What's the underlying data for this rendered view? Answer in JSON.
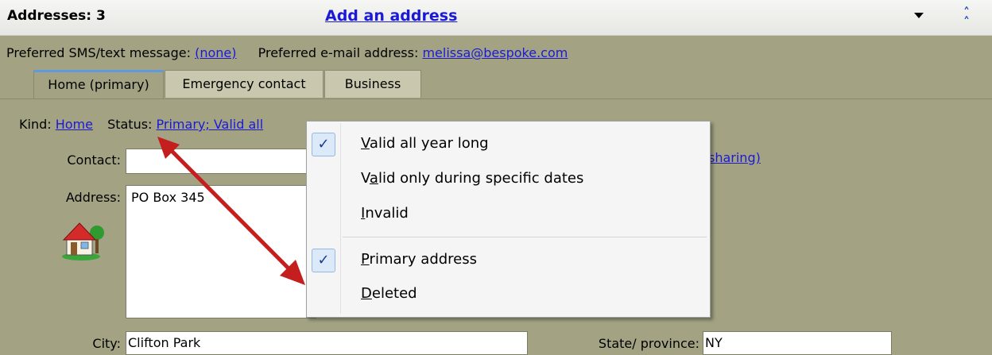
{
  "header": {
    "title": "Addresses: 3",
    "add_link": "Add an address",
    "dropdown_icon": "chevron-down-icon",
    "collapse_icon": "double-chevron-up-icon"
  },
  "preferences": {
    "sms_label": "Preferred SMS/text message:",
    "sms_value": "(none)",
    "email_label": "Preferred e-mail address:",
    "email_value": "melissa@bespoke.com"
  },
  "tabs": [
    {
      "label": "Home (primary)",
      "active": true
    },
    {
      "label": "Emergency contact",
      "active": false
    },
    {
      "label": "Business",
      "active": false
    }
  ],
  "form": {
    "kind_label": "Kind:",
    "kind_value": "Home",
    "status_label": "Status:",
    "status_value": "Primary; Valid all",
    "share_fragment": "sharing)",
    "contact_label": "Contact:",
    "contact_value": "",
    "address_label": "Address:",
    "address_value": "PO Box 345",
    "city_label": "City:",
    "city_value": "Clifton Park",
    "state_label": "State/ province:",
    "state_value": "NY"
  },
  "menu": {
    "items": [
      {
        "pre": "",
        "accel": "V",
        "post": "alid all year long",
        "checked": true
      },
      {
        "pre": "V",
        "accel": "a",
        "post": "lid only during specific dates",
        "checked": false
      },
      {
        "pre": "",
        "accel": "I",
        "post": "nvalid",
        "checked": false
      },
      {
        "pre": "",
        "accel": "P",
        "post": "rimary address",
        "checked": true
      },
      {
        "pre": "",
        "accel": "D",
        "post": "eleted",
        "checked": false
      }
    ],
    "check_glyph": "✓"
  },
  "colors": {
    "background": "#a3a384",
    "link": "#1a1ad6",
    "arrow": "#c41e1e",
    "check_bg": "#dbe9f8"
  }
}
